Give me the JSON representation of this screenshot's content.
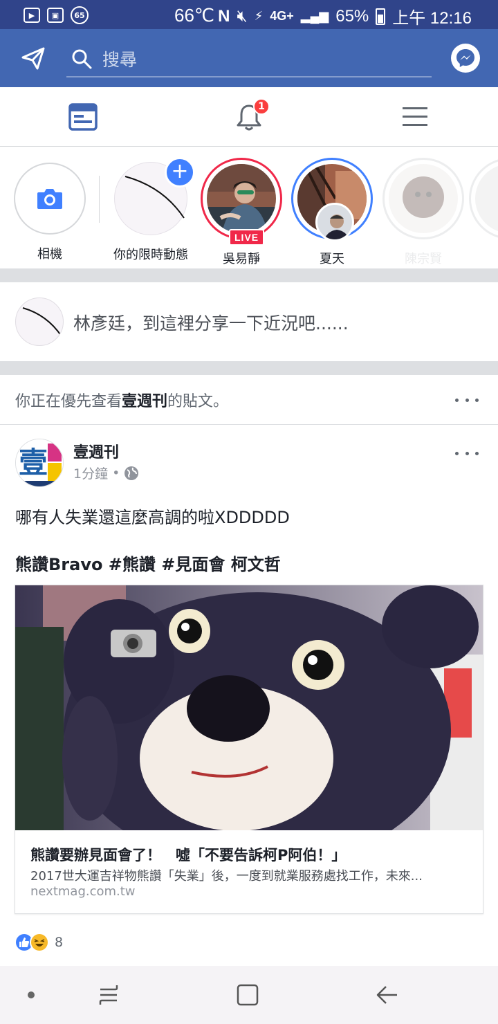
{
  "status_bar": {
    "left_badge": "65",
    "temperature": "66℃",
    "network": "4G+",
    "battery": "65%",
    "time": "上午 12:16"
  },
  "search": {
    "placeholder": "搜尋"
  },
  "tabs": {
    "notification_count": "1"
  },
  "stories": [
    {
      "label": "相機"
    },
    {
      "label": "你的限時動態"
    },
    {
      "label": "吳易靜",
      "live_label": "LIVE"
    },
    {
      "label": "夏天"
    },
    {
      "label": "陳宗賢"
    }
  ],
  "composer": {
    "prompt": "林彥廷，到這裡分享一下近況吧......"
  },
  "see_first": {
    "prefix": "你正在優先查看",
    "page": "壹週刊",
    "suffix": "的貼文。"
  },
  "post": {
    "author": "壹週刊",
    "time": "1分鐘",
    "separator": "•",
    "text_line1": "哪有人失業還這麼高調的啦XDDDDD",
    "text_line2": "熊讚Bravo #熊讚 #見面會 柯文哲",
    "link": {
      "title": "熊讚要辦見面會了！　噓「不要告訴柯P阿伯！」",
      "description": "2017世大運吉祥物熊讚「失業」後，一度到就業服務處找工作，未來...",
      "domain": "nextmag.com.tw"
    },
    "reaction_count": "8"
  },
  "colors": {
    "brand_blue": "#4267b2",
    "status_blue": "#30448a",
    "badge_red": "#fa3e3e",
    "live_red": "#f02849",
    "story_blue": "#4080ff"
  }
}
